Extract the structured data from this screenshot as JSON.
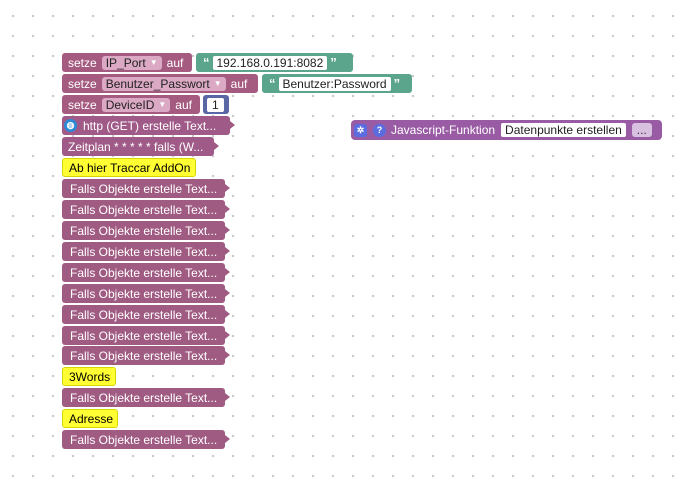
{
  "setters": [
    {
      "prefix": "setze",
      "var": "IP_Port",
      "mid": "auf",
      "open_quote": "“",
      "value": "192.168.0.191:8082",
      "close_quote": "”"
    },
    {
      "prefix": "setze",
      "var": "Benutzer_Passwort",
      "mid": "auf",
      "open_quote": "“",
      "value": "Benutzer:Password",
      "close_quote": "”"
    },
    {
      "prefix": "setze",
      "var": "DeviceID",
      "mid": "auf",
      "value": "1"
    }
  ],
  "http_block": "http (GET) erstelle Text...",
  "schedule_block": "Zeitplan * * * * * falls (W...",
  "comments": [
    "Ab hier Traccar AddOn",
    "3Words",
    "Adresse"
  ],
  "falls_label": "Falls Objekte erstelle Text...",
  "function_block": {
    "label": "Javascript-Funktion",
    "name": "Datenpunkte erstellen",
    "more": "..."
  },
  "colors": {
    "variable": "#a55b80",
    "text": "#5ba58c",
    "number": "#5b67a5",
    "function": "#9a5ba5",
    "comment": "#ffff33"
  },
  "icons": [
    "dropdown-arrow-icon",
    "globe-icon",
    "gear-icon",
    "help-icon"
  ]
}
